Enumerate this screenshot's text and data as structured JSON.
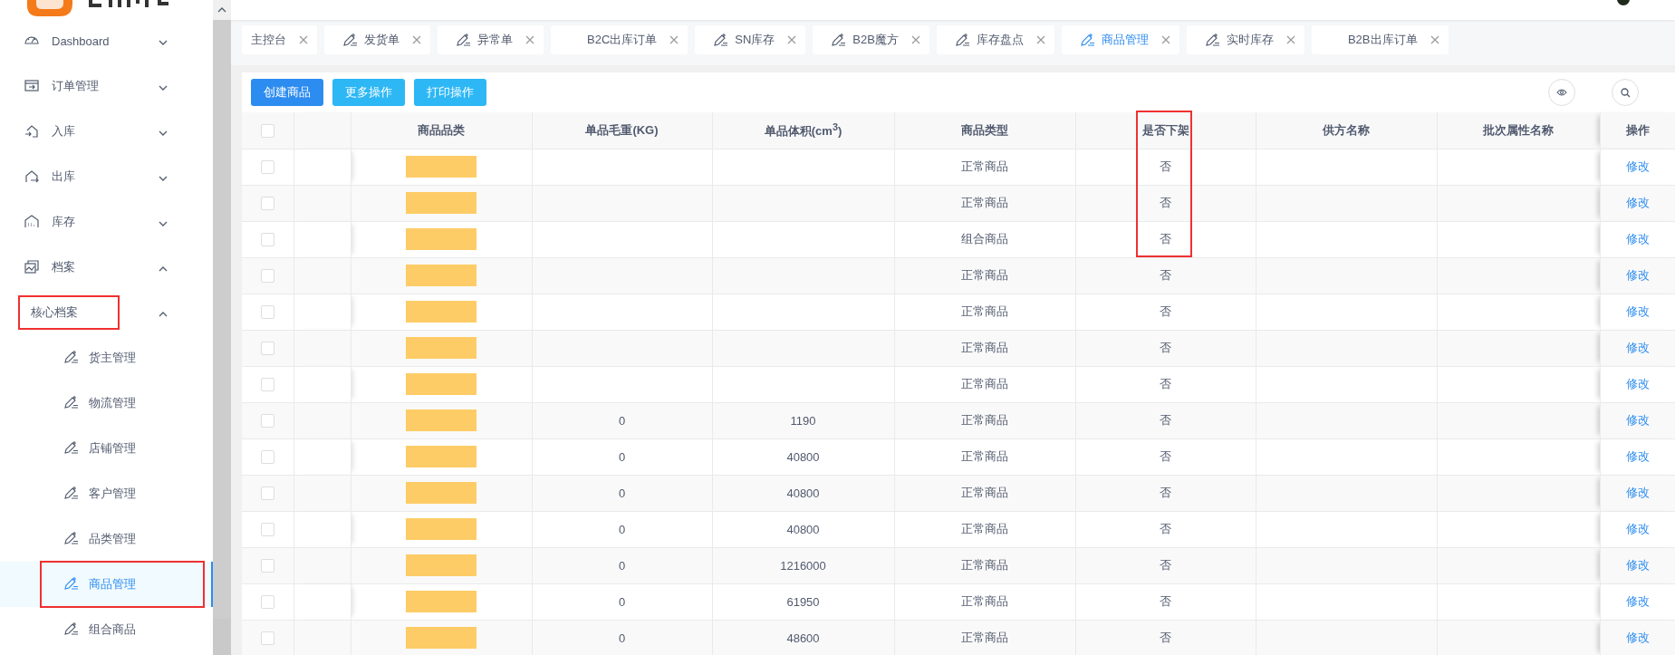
{
  "sidebar": {
    "items": [
      {
        "label": "Dashboard",
        "expanded": false,
        "selected": false,
        "highlighted": false
      },
      {
        "label": "订单管理",
        "expanded": false,
        "selected": false,
        "highlighted": false
      },
      {
        "label": "入库",
        "expanded": false,
        "selected": false,
        "highlighted": false
      },
      {
        "label": "出库",
        "expanded": false,
        "selected": false,
        "highlighted": false
      },
      {
        "label": "库存",
        "expanded": false,
        "selected": false,
        "highlighted": false
      },
      {
        "label": "档案",
        "expanded": true,
        "selected": false,
        "highlighted": false,
        "children": [
          {
            "label": "核心档案",
            "expanded": true,
            "selected": false,
            "highlighted": true,
            "children": [
              {
                "label": "货主管理",
                "selected": false,
                "highlighted": false
              },
              {
                "label": "物流管理",
                "selected": false,
                "highlighted": false
              },
              {
                "label": "店铺管理",
                "selected": false,
                "highlighted": false
              },
              {
                "label": "客户管理",
                "selected": false,
                "highlighted": false
              },
              {
                "label": "品类管理",
                "selected": false,
                "highlighted": false
              },
              {
                "label": "商品管理",
                "selected": true,
                "highlighted": true
              },
              {
                "label": "组合商品",
                "selected": false,
                "highlighted": false
              }
            ]
          }
        ]
      }
    ]
  },
  "tabs": [
    {
      "label": "主控台",
      "icon": false,
      "selected": false
    },
    {
      "label": "发货单",
      "icon": true,
      "selected": false
    },
    {
      "label": "异常单",
      "icon": true,
      "selected": false
    },
    {
      "label": "B2C出库订单",
      "icon": false,
      "selected": false
    },
    {
      "label": "SN库存",
      "icon": true,
      "selected": false
    },
    {
      "label": "B2B魔方",
      "icon": true,
      "selected": false
    },
    {
      "label": "库存盘点",
      "icon": true,
      "selected": false
    },
    {
      "label": "商品管理",
      "icon": true,
      "selected": true
    },
    {
      "label": "实时库存",
      "icon": true,
      "selected": false
    },
    {
      "label": "B2B出库订单",
      "icon": false,
      "selected": false
    }
  ],
  "toolbar": {
    "buttons": [
      {
        "label": "创建商品",
        "kind": "primary"
      },
      {
        "label": "更多操作",
        "kind": "info"
      },
      {
        "label": "打印操作",
        "kind": "info"
      }
    ]
  },
  "table": {
    "all_checked": false,
    "columns": [
      {
        "label": "商品品类",
        "highlighted": false
      },
      {
        "label": "单品毛重(KG)",
        "highlighted": false
      },
      {
        "label": "单品体积(cm$^{3}$)",
        "highlighted": false
      },
      {
        "label": "商品类型",
        "highlighted": false
      },
      {
        "label": "是否下架",
        "highlighted": true
      },
      {
        "label": "供方名称",
        "highlighted": false
      },
      {
        "label": "批次属性名称",
        "highlighted": false
      },
      {
        "label": "操作",
        "highlighted": false
      }
    ],
    "rows": [
      {
        "checked": false,
        "weight": "",
        "volume": "",
        "type": "正常商品",
        "off_shelf": "否",
        "action": "修改",
        "highlighted": true
      },
      {
        "checked": false,
        "weight": "",
        "volume": "",
        "type": "正常商品",
        "off_shelf": "否",
        "action": "修改",
        "highlighted": true
      },
      {
        "checked": false,
        "weight": "",
        "volume": "",
        "type": "组合商品",
        "off_shelf": "否",
        "action": "修改",
        "highlighted": true
      },
      {
        "checked": false,
        "weight": "",
        "volume": "",
        "type": "正常商品",
        "off_shelf": "否",
        "action": "修改",
        "highlighted": false
      },
      {
        "checked": false,
        "weight": "",
        "volume": "",
        "type": "正常商品",
        "off_shelf": "否",
        "action": "修改",
        "highlighted": false
      },
      {
        "checked": false,
        "weight": "",
        "volume": "",
        "type": "正常商品",
        "off_shelf": "否",
        "action": "修改",
        "highlighted": false
      },
      {
        "checked": false,
        "weight": "",
        "volume": "",
        "type": "正常商品",
        "off_shelf": "否",
        "action": "修改",
        "highlighted": false
      },
      {
        "checked": false,
        "weight": "0",
        "volume": "1190",
        "type": "正常商品",
        "off_shelf": "否",
        "action": "修改",
        "highlighted": false
      },
      {
        "checked": false,
        "weight": "0",
        "volume": "40800",
        "type": "正常商品",
        "off_shelf": "否",
        "action": "修改",
        "highlighted": false
      },
      {
        "checked": false,
        "weight": "0",
        "volume": "40800",
        "type": "正常商品",
        "off_shelf": "否",
        "action": "修改",
        "highlighted": false
      },
      {
        "checked": false,
        "weight": "0",
        "volume": "40800",
        "type": "正常商品",
        "off_shelf": "否",
        "action": "修改",
        "highlighted": false
      },
      {
        "checked": false,
        "weight": "0",
        "volume": "1216000",
        "type": "正常商品",
        "off_shelf": "否",
        "action": "修改",
        "highlighted": false
      },
      {
        "checked": false,
        "weight": "0",
        "volume": "61950",
        "type": "正常商品",
        "off_shelf": "否",
        "action": "修改",
        "highlighted": false
      },
      {
        "checked": false,
        "weight": "0",
        "volume": "48600",
        "type": "正常商品",
        "off_shelf": "否",
        "action": "修改",
        "highlighted": false
      }
    ]
  }
}
